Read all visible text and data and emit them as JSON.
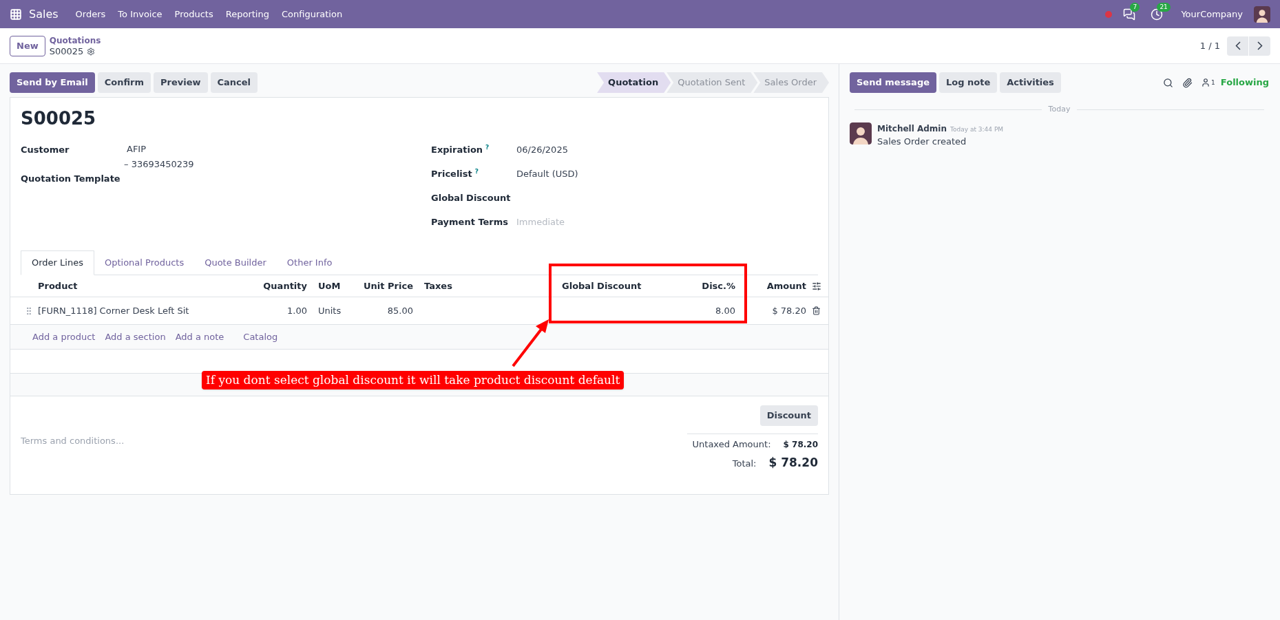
{
  "navbar": {
    "app": "Sales",
    "menu": [
      "Orders",
      "To Invoice",
      "Products",
      "Reporting",
      "Configuration"
    ],
    "messages_badge": "7",
    "activities_badge": "21",
    "company": "YourCompany"
  },
  "control_panel": {
    "new_button": "New",
    "breadcrumb": "Quotations",
    "record": "S00025",
    "pager": "1 / 1"
  },
  "actions": [
    {
      "label": "Send by Email",
      "kind": "primary"
    },
    {
      "label": "Confirm",
      "kind": "secondary"
    },
    {
      "label": "Preview",
      "kind": "secondary"
    },
    {
      "label": "Cancel",
      "kind": "secondary"
    }
  ],
  "statusbar": [
    {
      "label": "Quotation",
      "selected": true
    },
    {
      "label": "Quotation Sent",
      "selected": false
    },
    {
      "label": "Sales Order",
      "selected": false
    }
  ],
  "form": {
    "title": "S00025",
    "left_fields": [
      {
        "label": "Customer",
        "lines": [
          "AFIP",
          "– 33693450239"
        ]
      },
      {
        "label": "Quotation Template"
      }
    ],
    "right_fields": [
      {
        "label": "Expiration",
        "help": "?",
        "value": "06/26/2025"
      },
      {
        "label": "Pricelist",
        "help": "?",
        "value": "Default (USD)"
      },
      {
        "label": "Global Discount"
      },
      {
        "label": "Payment Terms",
        "placeholder": "Immediate"
      }
    ]
  },
  "tabs": [
    {
      "label": "Order Lines",
      "selected": true
    },
    {
      "label": "Optional Products",
      "selected": false
    },
    {
      "label": "Quote Builder",
      "selected": false
    },
    {
      "label": "Other Info",
      "selected": false
    }
  ],
  "order_lines": {
    "columns": [
      {
        "label": "Product",
        "kind": "text"
      },
      {
        "label": "Quantity",
        "kind": "number"
      },
      {
        "label": "UoM",
        "kind": "text"
      },
      {
        "label": "Unit Price",
        "kind": "number"
      },
      {
        "label": "Taxes",
        "kind": "text"
      },
      {
        "label": "Global Discount",
        "kind": "text"
      },
      {
        "label": "Disc.%",
        "kind": "number"
      },
      {
        "label": "Amount",
        "kind": "number"
      }
    ],
    "rows": [
      {
        "cells": [
          "[FURN_1118] Corner Desk Left Sit",
          "1.00",
          "Units",
          "85.00",
          null,
          null,
          "8.00",
          "$ 78.20"
        ]
      }
    ],
    "add_links": [
      "Add a product",
      "Add a section",
      "Add a note",
      "Catalog"
    ]
  },
  "totals": {
    "discount_button": "Discount",
    "terms_placeholder": "Terms and conditions...",
    "rows": [
      {
        "label": "Untaxed Amount:",
        "value": "$ 78.20",
        "kind": "subtotal"
      },
      {
        "label": "Total:",
        "value": "$ 78.20",
        "kind": "total"
      }
    ]
  },
  "chatter": {
    "buttons": [
      {
        "label": "Send message",
        "kind": "primary"
      },
      {
        "label": "Log note",
        "kind": "secondary"
      },
      {
        "label": "Activities",
        "kind": "secondary"
      }
    ],
    "follower_count": "1",
    "follow_label": "Following",
    "divider": "Today",
    "messages": [
      {
        "author": "Mitchell Admin",
        "time": "Today at 3:44 PM",
        "body": "Sales Order created"
      }
    ]
  },
  "annotation": {
    "text": "If you dont select global discount it will take product discount default"
  }
}
